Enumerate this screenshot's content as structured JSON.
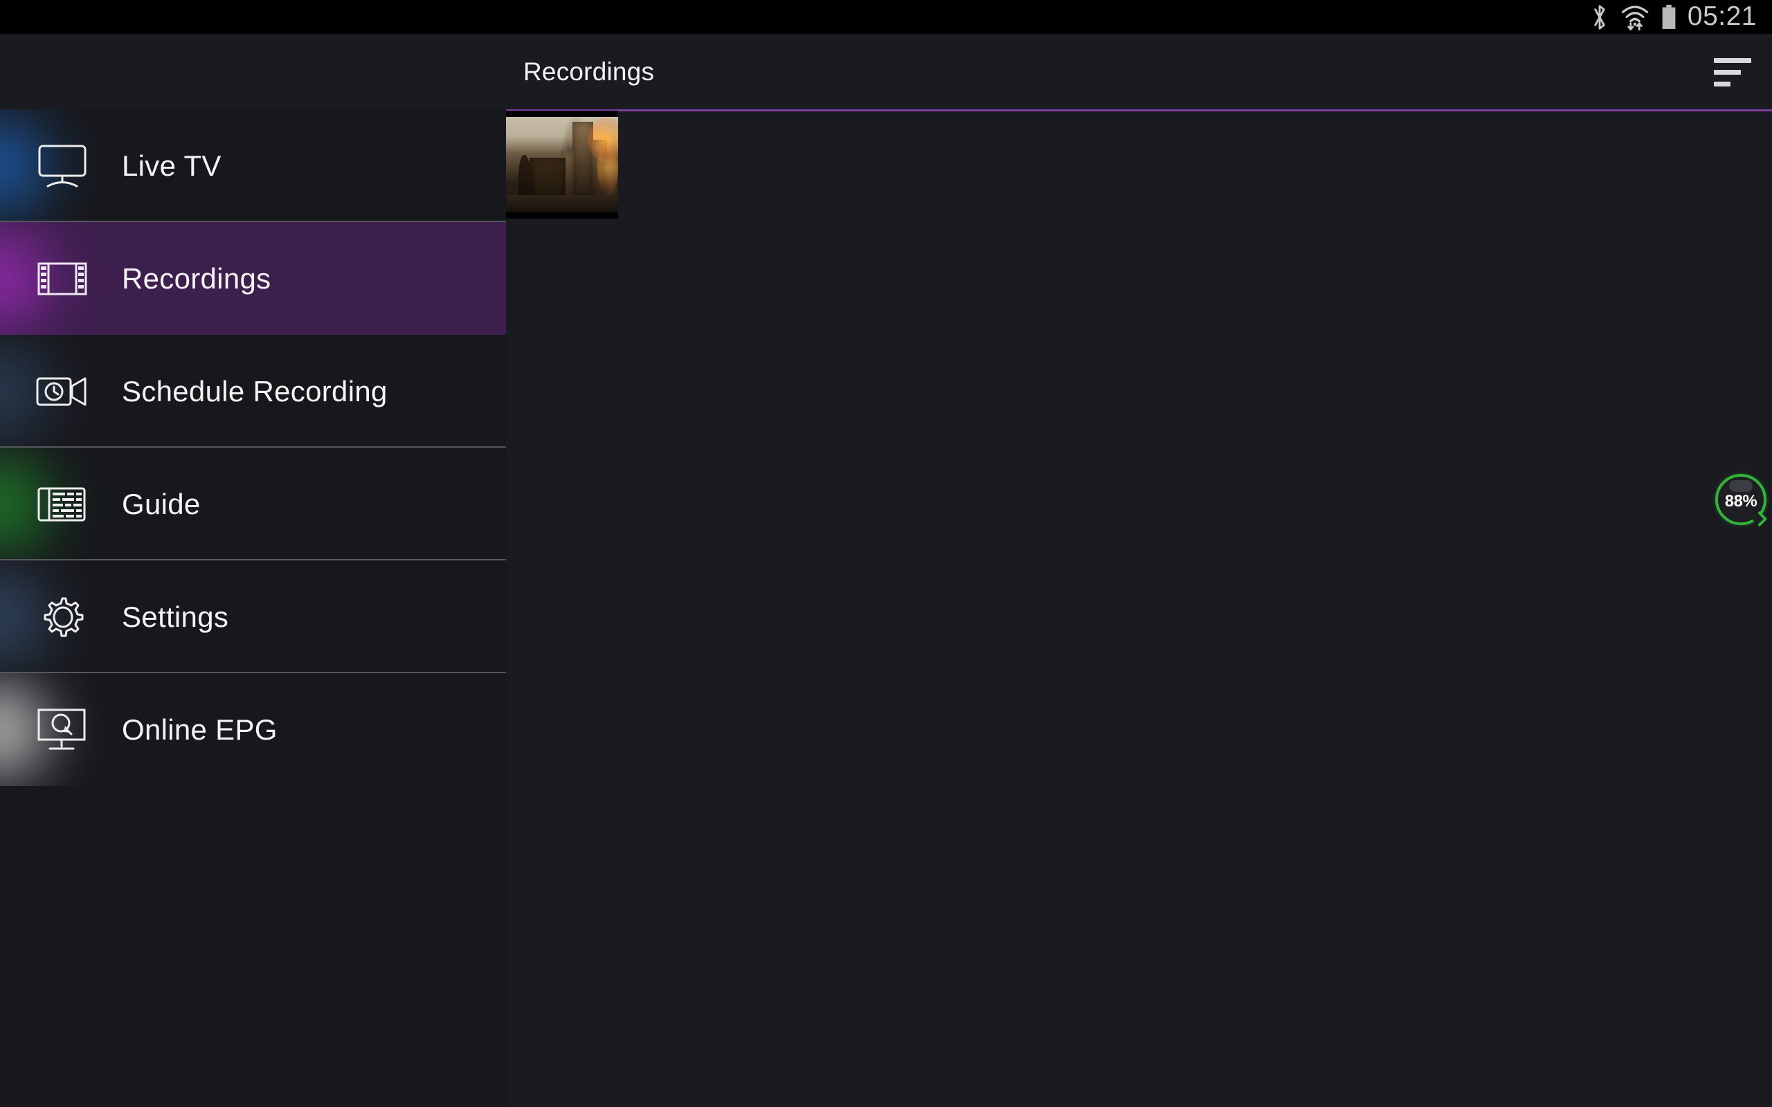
{
  "status_bar": {
    "icons": [
      "bluetooth-icon",
      "wifi-icon",
      "battery-icon"
    ],
    "time": "05:21",
    "background": "#000000"
  },
  "app_bar": {
    "title": "Recordings",
    "sort_icon": "sort-icon",
    "background": "#1a1b20",
    "accent_color": "#7c3fa0"
  },
  "sidebar": {
    "active_index": 1,
    "items": [
      {
        "label": "Live TV",
        "icon": "television-icon",
        "glow": "#1f6fd0",
        "active": false
      },
      {
        "label": "Recordings",
        "icon": "film-strip-icon",
        "glow": "#a32ec0",
        "active": true
      },
      {
        "label": "Schedule Recording",
        "icon": "video-camera-clock-icon",
        "glow": "#26405e",
        "active": false
      },
      {
        "label": "Guide",
        "icon": "program-guide-icon",
        "glow": "#1e8f2a",
        "active": false
      },
      {
        "label": "Settings",
        "icon": "gear-icon",
        "glow": "#2c4a6b",
        "active": false
      },
      {
        "label": "Online EPG",
        "icon": "monitor-search-icon",
        "glow": "#e8e8e8",
        "active": false
      }
    ]
  },
  "content": {
    "thumbnail": {
      "name": "recording-thumbnail",
      "description": "Destroyed city skyline with burning buildings and silhouetted figure"
    }
  },
  "battery_widget": {
    "percent_label": "88%",
    "ring_color": "#35b23a"
  }
}
